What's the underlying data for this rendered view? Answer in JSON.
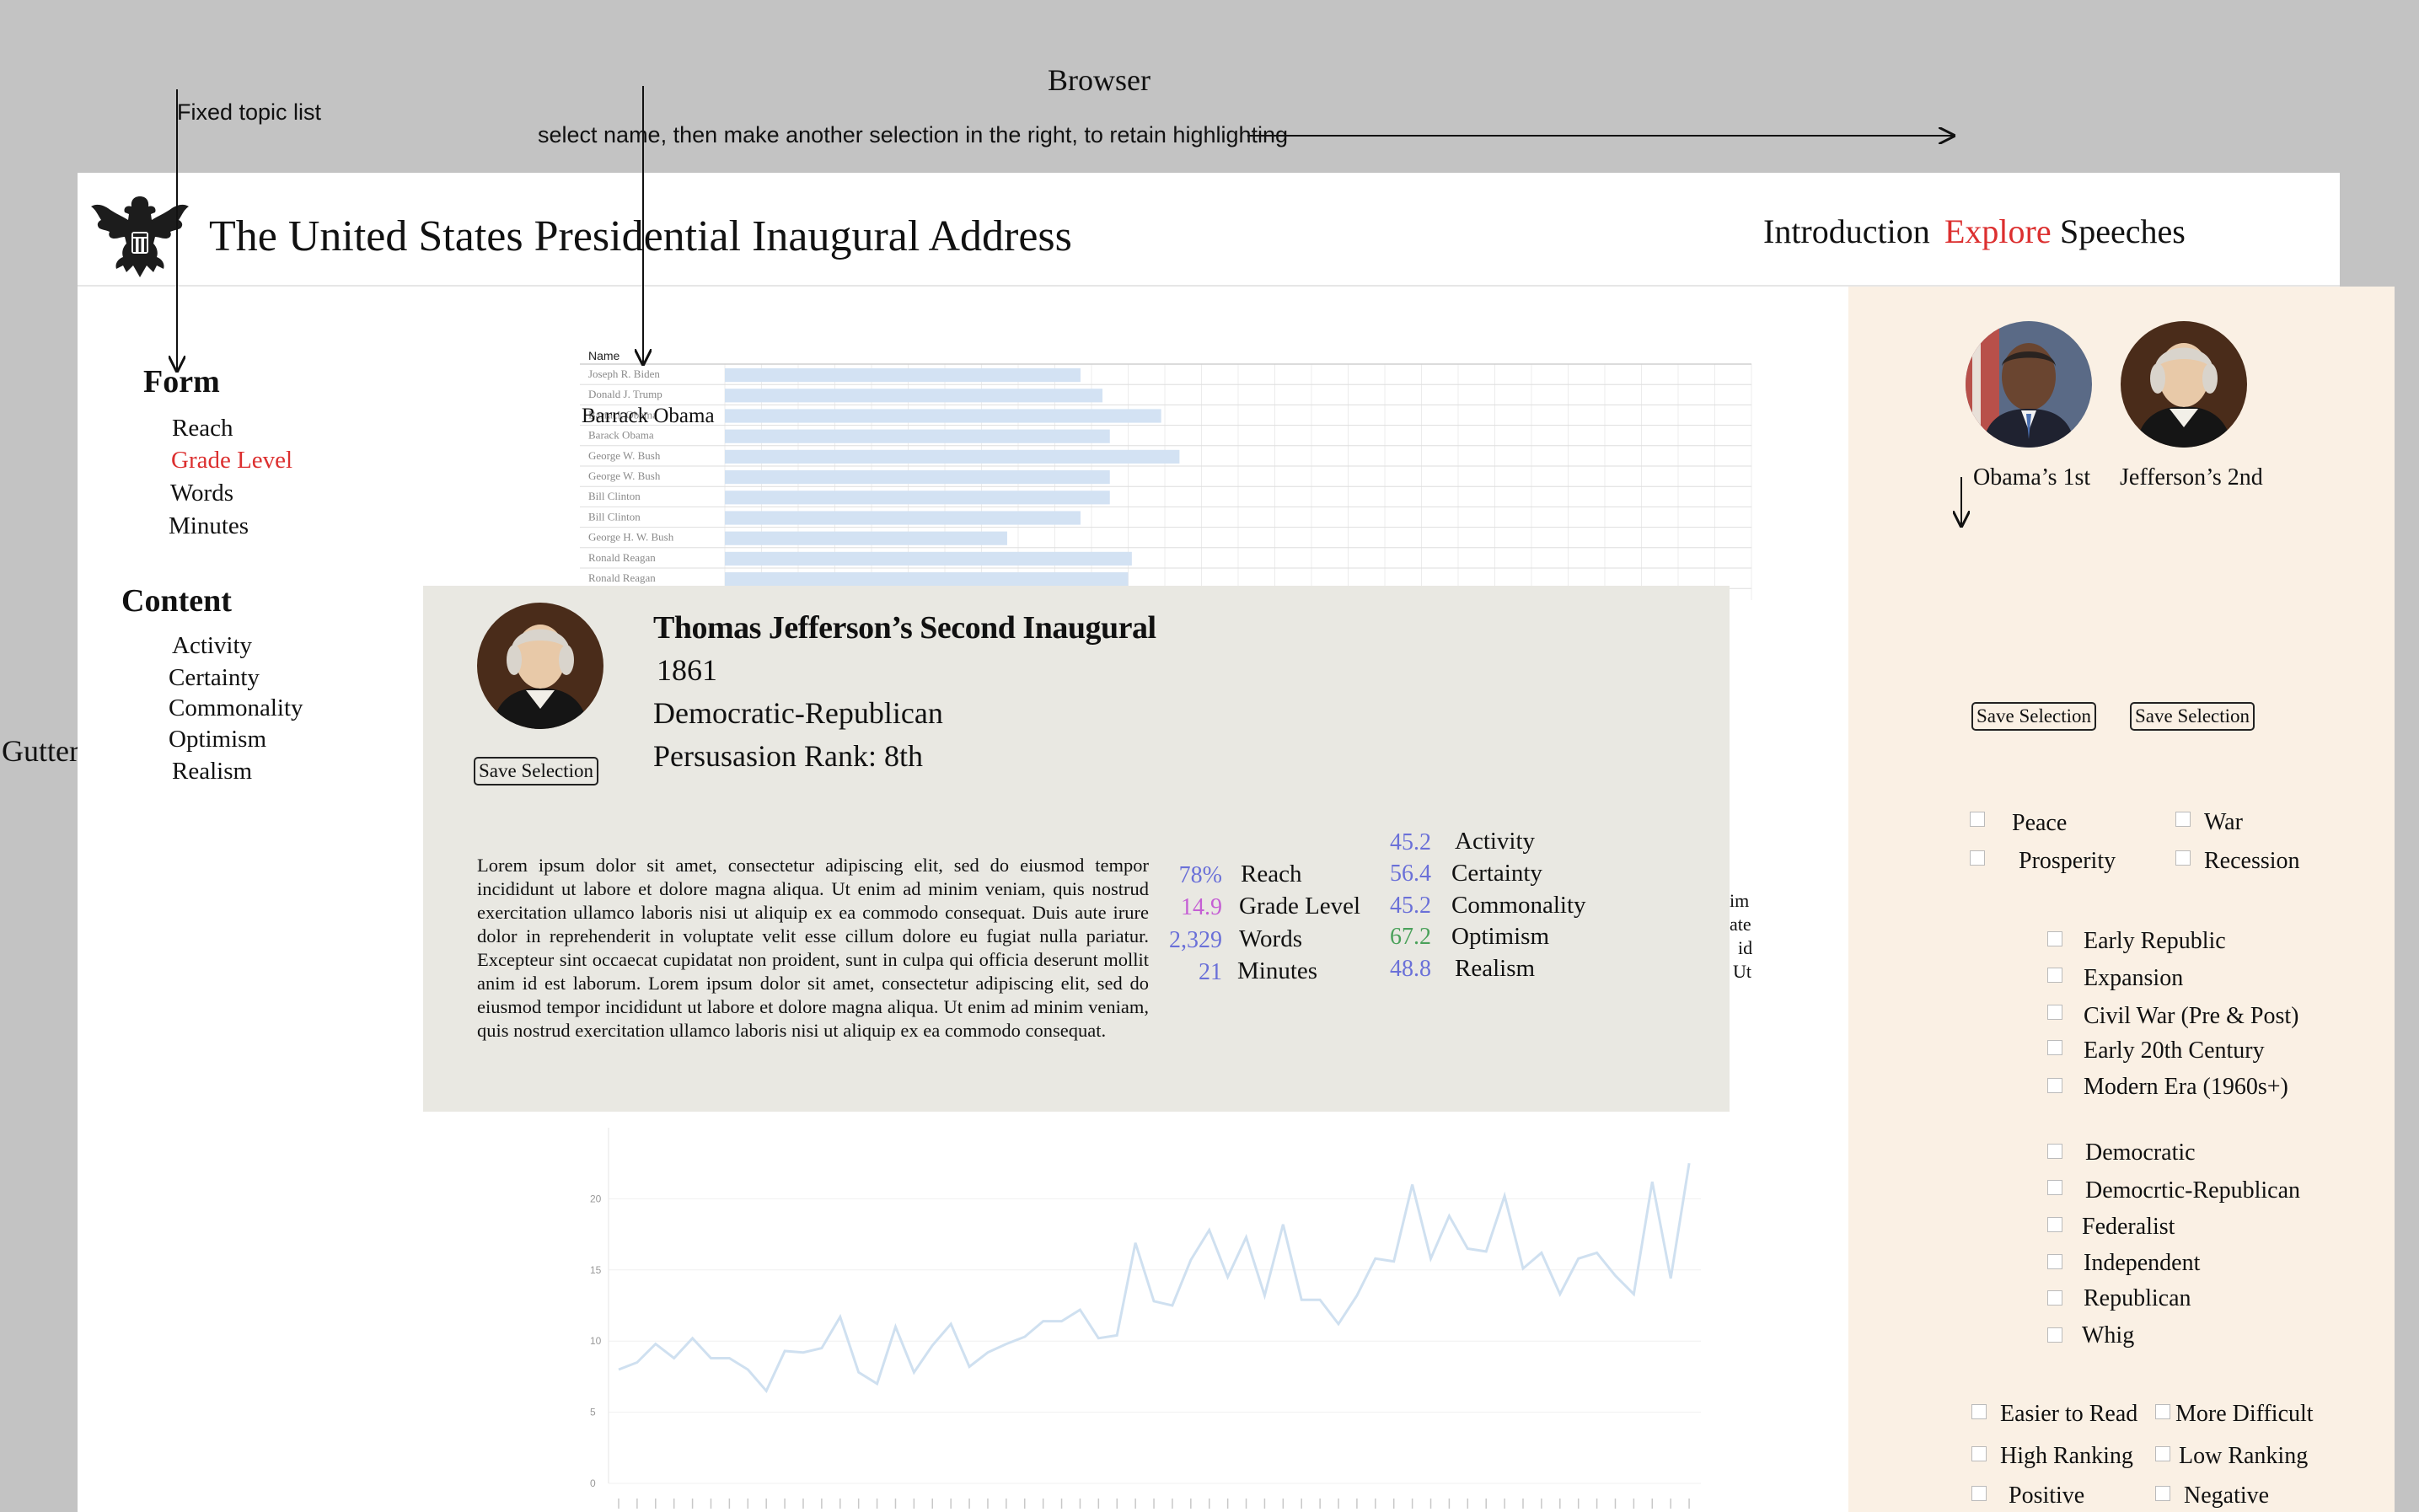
{
  "annotations": {
    "browser": "Browser",
    "fixed_topic_list": "Fixed topic list",
    "select_hint": "select name, then make another selection in the right, to retain highlighting",
    "gutter": "Gutter",
    "hover_label": "Barrack Obama"
  },
  "header": {
    "title": "The United States Presidential Inaugural Address",
    "nav": {
      "introduction": "Introduction",
      "explore": "Explore",
      "speeches": "Speeches"
    }
  },
  "topics": {
    "form": {
      "heading": "Form",
      "items": [
        "Reach",
        "Grade Level",
        "Words",
        "Minutes"
      ]
    },
    "content": {
      "heading": "Content",
      "items": [
        "Activity",
        "Certainty",
        "Commonality",
        "Optimism",
        "Realism"
      ]
    }
  },
  "chart_data": [
    {
      "type": "bar",
      "xlabel": "",
      "ylabel": "Name",
      "categories": [
        "Joseph R. Biden",
        "Donald J. Trump",
        "Barrack Obama",
        "Barack Obama",
        "George W. Bush",
        "George W. Bush",
        "Bill Clinton",
        "Bill Clinton",
        "George H. W. Bush",
        "Ronald Reagan",
        "Ronald Reagan"
      ],
      "values": [
        9.7,
        10.3,
        11.9,
        10.5,
        12.4,
        10.5,
        10.5,
        9.7,
        7.7,
        11.1,
        11.0
      ],
      "xlim": [
        0,
        28
      ],
      "grid": true,
      "note_values_estimated": true
    },
    {
      "type": "line",
      "title": "",
      "xlabel": "",
      "ylabel": "",
      "ylim": [
        0,
        25
      ],
      "yticks": [
        0,
        5,
        10,
        15,
        20
      ],
      "color": "#cfe0f0",
      "values": [
        8.0,
        8.5,
        9.8,
        8.8,
        10.2,
        8.8,
        8.8,
        8.0,
        6.5,
        9.3,
        9.2,
        9.5,
        11.7,
        7.8,
        7.0,
        11.0,
        7.8,
        9.7,
        11.2,
        8.2,
        9.2,
        9.8,
        10.3,
        11.4,
        11.4,
        12.2,
        10.2,
        10.4,
        16.9,
        12.8,
        12.5,
        15.7,
        17.8,
        14.5,
        17.3,
        13.2,
        18.2,
        12.9,
        12.9,
        11.2,
        13.2,
        15.8,
        15.6,
        21.0,
        15.8,
        18.8,
        16.5,
        16.3,
        20.2,
        15.1,
        16.2,
        13.3,
        15.8,
        16.2,
        14.6,
        13.3,
        21.2,
        14.4,
        22.5
      ]
    }
  ],
  "card": {
    "title": "Thomas Jefferson’s Second Inaugural",
    "year": "1861",
    "party": "Democratic-Republican",
    "rank_label": "Persusasion Rank:",
    "rank_value": "8th",
    "save_label": "Save Selection",
    "body": "Lorem ipsum dolor sit amet, consectetur adipiscing elit, sed do eiusmod tempor incididunt ut labore et dolore magna aliqua. Ut enim ad minim veniam, quis nostrud exercitation ullamco laboris nisi ut aliquip ex ea commodo consequat. Duis aute irure dolor in reprehenderit in voluptate velit esse cillum dolore eu fugiat nulla pariatur. Excepteur sint occaecat cupidatat non proident, sunt in culpa qui officia deserunt mollit anim id est laborum.  Lorem ipsum dolor sit amet, consectetur adipiscing elit, sed do eiusmod tempor incididunt ut labore et dolore magna aliqua. Ut enim ad minim veniam, quis nostrud exercitation ullamco laboris nisi ut aliquip ex ea commodo consequat.",
    "form_stats": [
      {
        "value": "78%",
        "label": "Reach",
        "color": "#6a70d8"
      },
      {
        "value": "14.9",
        "label": "Grade Level",
        "color": "#c55fd4"
      },
      {
        "value": "2,329",
        "label": "Words",
        "color": "#6a70d8"
      },
      {
        "value": "21",
        "label": "Minutes",
        "color": "#6a70d8"
      }
    ],
    "content_stats": [
      {
        "value": "45.2",
        "label": "Activity",
        "color": "#6a70d8"
      },
      {
        "value": "56.4",
        "label": "Certainty",
        "color": "#6a70d8"
      },
      {
        "value": "45.2",
        "label": "Commonality",
        "color": "#6a70d8"
      },
      {
        "value": "67.2",
        "label": "Optimism",
        "color": "#4aa15a"
      },
      {
        "value": "48.8",
        "label": "Realism",
        "color": "#6a70d8"
      }
    ],
    "behind_text": [
      "im",
      "ate",
      "id",
      "Ut"
    ]
  },
  "right_panel": {
    "selections": [
      {
        "label": "Obama’s 1st",
        "save": "Save Selection"
      },
      {
        "label": "Jefferson’s 2nd",
        "save": "Save Selection"
      }
    ],
    "theme_filters": [
      "Peace",
      "War",
      "Prosperity",
      "Recession"
    ],
    "era_filters": [
      "Early Republic",
      "Expansion",
      "Civil War (Pre & Post)",
      "Early 20th Century",
      "Modern Era (1960s+)"
    ],
    "party_filters": [
      "Democratic",
      "Democrtic-Republican",
      "Federalist",
      "Independent",
      "Republican",
      "Whig"
    ],
    "quality_filters": [
      "Easier to Read",
      "More Difficult",
      "High Ranking",
      "Low Ranking",
      "Positive",
      "Negative"
    ]
  },
  "colors": {
    "accent": "#dc2f2f",
    "panel": "#faf0e4",
    "card": "#e9e8e2",
    "bar": "#d3e2f3"
  },
  "icons": [
    "eagle-seal-icon"
  ]
}
